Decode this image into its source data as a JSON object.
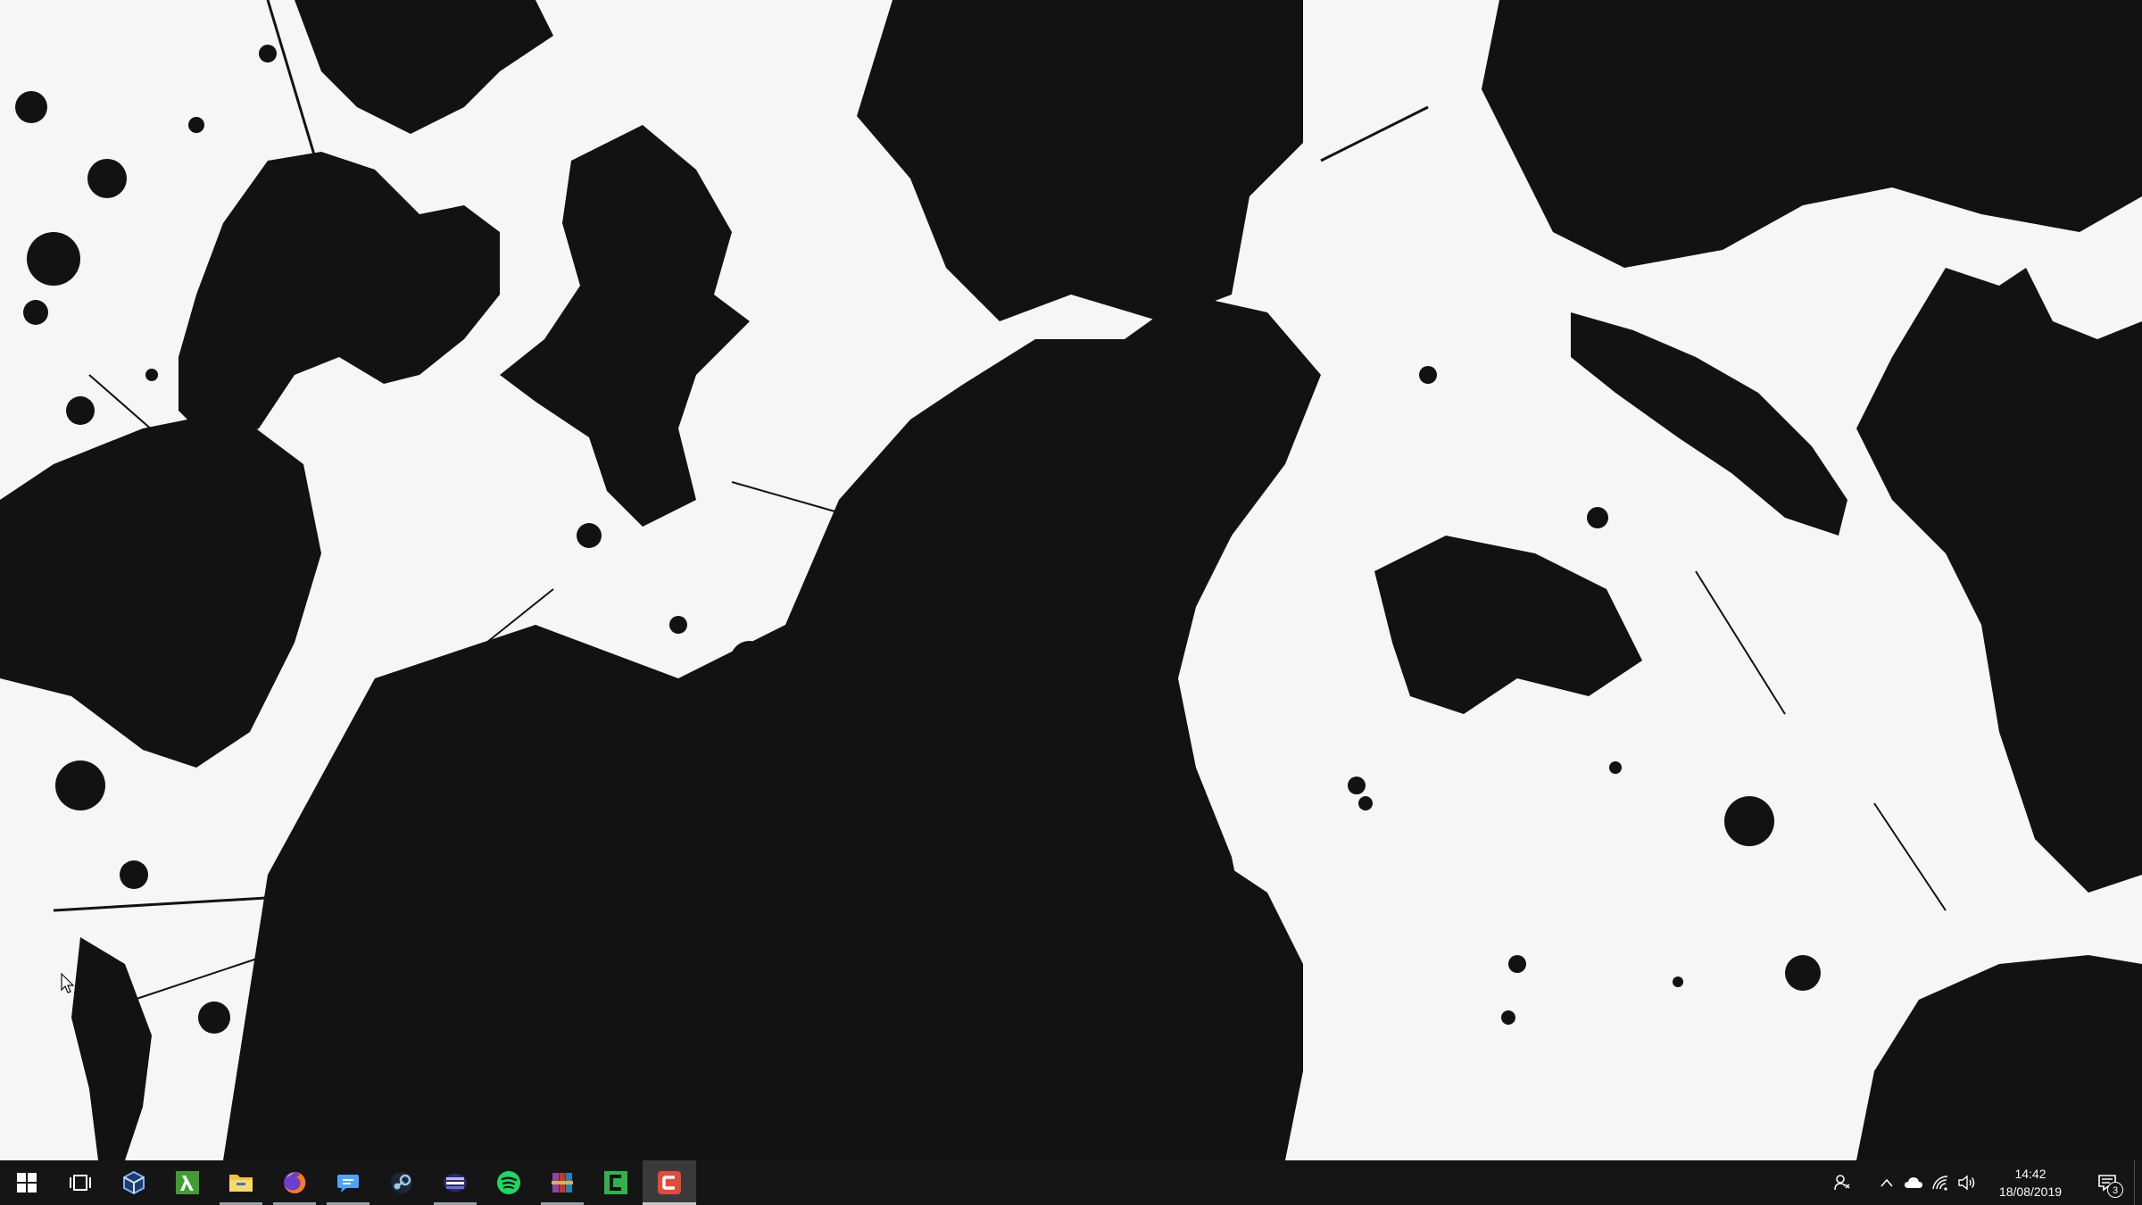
{
  "desktop": {
    "wallpaper": "black-ink-splatter",
    "colors": {
      "ink": "#121212",
      "paper": "#f6f6f6"
    }
  },
  "taskbar": {
    "background": "#151515",
    "pinned": [
      {
        "name": "start-button",
        "icon": "windows-logo-icon",
        "color": "#ffffff",
        "running": false
      },
      {
        "name": "task-view-button",
        "icon": "task-view-icon",
        "color": "#ffffff",
        "running": false
      },
      {
        "name": "3d-viewer-button",
        "icon": "cube-icon",
        "color": "#7fb3ff",
        "running": false
      },
      {
        "name": "lambda-app-button",
        "icon": "lambda-icon",
        "color": "#3f9e2f",
        "running": false
      },
      {
        "name": "file-explorer-button",
        "icon": "folder-icon",
        "color": "#f2c43d",
        "running": true
      },
      {
        "name": "firefox-button",
        "icon": "firefox-icon",
        "color": "#ff7a1a",
        "running": true
      },
      {
        "name": "chat-app-button",
        "icon": "chat-bubble-icon",
        "color": "#4da3ff",
        "running": true
      },
      {
        "name": "steam-button",
        "icon": "steam-icon",
        "color": "#9fc6e6",
        "running": false
      },
      {
        "name": "stacked-app-button",
        "icon": "stacked-bars-icon",
        "color": "#6c6ce0",
        "running": true
      },
      {
        "name": "spotify-button",
        "icon": "spotify-icon",
        "color": "#1ed760",
        "running": false
      },
      {
        "name": "winrar-button",
        "icon": "archive-books-icon",
        "color": "#c0392b",
        "running": true
      },
      {
        "name": "camtasia-button",
        "icon": "green-c-icon",
        "color": "#2fb34a",
        "running": false
      },
      {
        "name": "recorder-button",
        "icon": "red-c-icon",
        "color": "#e24a3b",
        "running": true,
        "active": true
      }
    ]
  },
  "tray": {
    "clock_time": "14:42",
    "clock_date": "18/08/2019",
    "notification_count": "3"
  }
}
